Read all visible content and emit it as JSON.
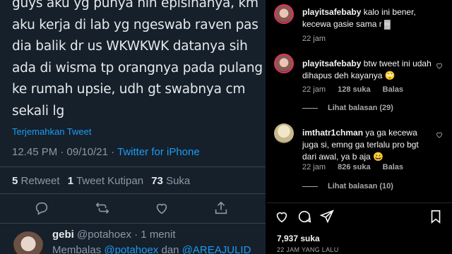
{
  "tweet": {
    "text_lines": [
      "guys aku yg punya nih episinanya, km",
      "aku kerja di lab yg ngeswab raven pas",
      "dia balik dr us WKWKWK datanya sih",
      "ada di wisma tp orangnya pada pulang",
      "ke rumah upsie, udh gt swabnya cm",
      "sekali lg"
    ],
    "translate_label": "Terjemahkan Tweet",
    "time": "12.45 PM · 09/10/21 · ",
    "client": "Twitter for iPhone",
    "stats": [
      {
        "count": "5",
        "label": "Retweet"
      },
      {
        "count": "1",
        "label": "Tweet Kutipan"
      },
      {
        "count": "73",
        "label": "Suka"
      }
    ],
    "actions": [
      "reply-icon",
      "retweet-icon",
      "like-icon",
      "share-icon"
    ],
    "reply": {
      "name": "gebi",
      "handle": "@potahoex",
      "age": "· 1 menit",
      "prefix": "Membalas ",
      "mention_1": "@potahoex",
      "joiner": " dan ",
      "mention_2": "@AREAJULID"
    }
  },
  "instagram": {
    "comments": [
      {
        "user": "playitsafebaby",
        "text": "kalo ini bener, kecewa gasie sama r ▓",
        "time": "22 jam",
        "likes": "",
        "reply_label": "",
        "view_replies": ""
      },
      {
        "user": "playitsafebaby",
        "text": "btw tweet ini udah dihapus deh kayanya 🙄",
        "time": "22 jam",
        "likes": "128 suka",
        "reply_label": "Balas",
        "view_replies": "Lihat balasan (29)"
      },
      {
        "user": "imthatr1chman",
        "text": "ya ga kecewa juga si, emng ga terlalu pro bgt dari awal, ya b aja 😀",
        "time": "22 jam",
        "likes": "826 suka",
        "reply_label": "Balas",
        "view_replies": "Lihat balasan (10)"
      }
    ],
    "actions": [
      "heart-icon",
      "comment-icon",
      "send-icon",
      "bookmark-icon"
    ],
    "likes_total": "7,937 suka",
    "posted": "22 JAM YANG LALU"
  }
}
